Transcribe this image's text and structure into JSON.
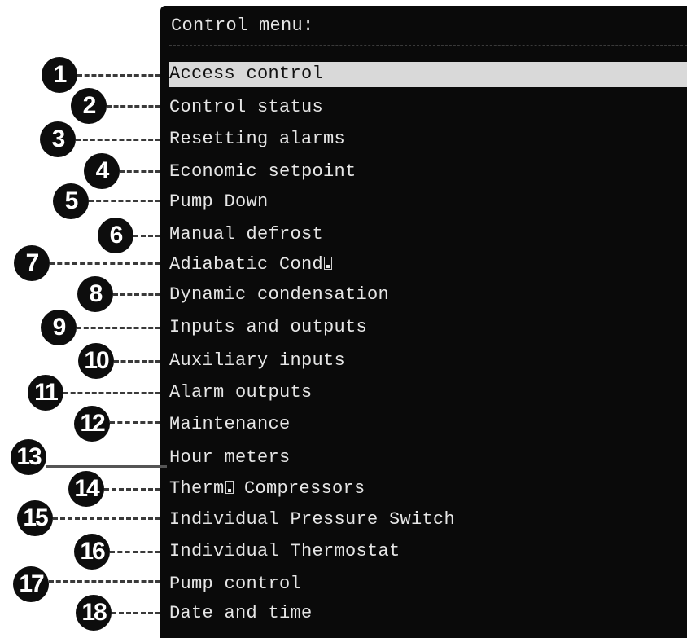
{
  "menu": {
    "title": "Control menu:",
    "items": [
      {
        "num": "1",
        "pre": "Access control",
        "post": ""
      },
      {
        "num": "2",
        "pre": "Control status",
        "post": ""
      },
      {
        "num": "3",
        "pre": "Resetting alarms",
        "post": ""
      },
      {
        "num": "4",
        "pre": "Economic setpoint",
        "post": ""
      },
      {
        "num": "5",
        "pre": "Pump Down",
        "post": ""
      },
      {
        "num": "6",
        "pre": "Manual defrost",
        "post": ""
      },
      {
        "num": "7",
        "pre": "Adiabatic Cond",
        "post": ""
      },
      {
        "num": "8",
        "pre": "Dynamic condensation",
        "post": ""
      },
      {
        "num": "9",
        "pre": "Inputs and outputs",
        "post": ""
      },
      {
        "num": "10",
        "pre": "Auxiliary inputs",
        "post": ""
      },
      {
        "num": "11",
        "pre": "Alarm outputs",
        "post": ""
      },
      {
        "num": "12",
        "pre": "Maintenance",
        "post": ""
      },
      {
        "num": "13",
        "pre": "Hour meters",
        "post": ""
      },
      {
        "num": "14",
        "pre": "Therm",
        "post": " Compressors"
      },
      {
        "num": "15",
        "pre": "Individual Pressure Switch",
        "post": ""
      },
      {
        "num": "16",
        "pre": "Individual Thermostat",
        "post": ""
      },
      {
        "num": "17",
        "pre": "Pump control",
        "post": ""
      },
      {
        "num": "18",
        "pre": "Date and time",
        "post": ""
      }
    ],
    "selected_index": 0
  },
  "colors": {
    "screen_bg": "#0a0a0a",
    "text": "#e6e6e6",
    "highlight_bg": "#d9d9d9",
    "badge_bg": "#0d0d0d",
    "leader": "#3a3a3a"
  }
}
